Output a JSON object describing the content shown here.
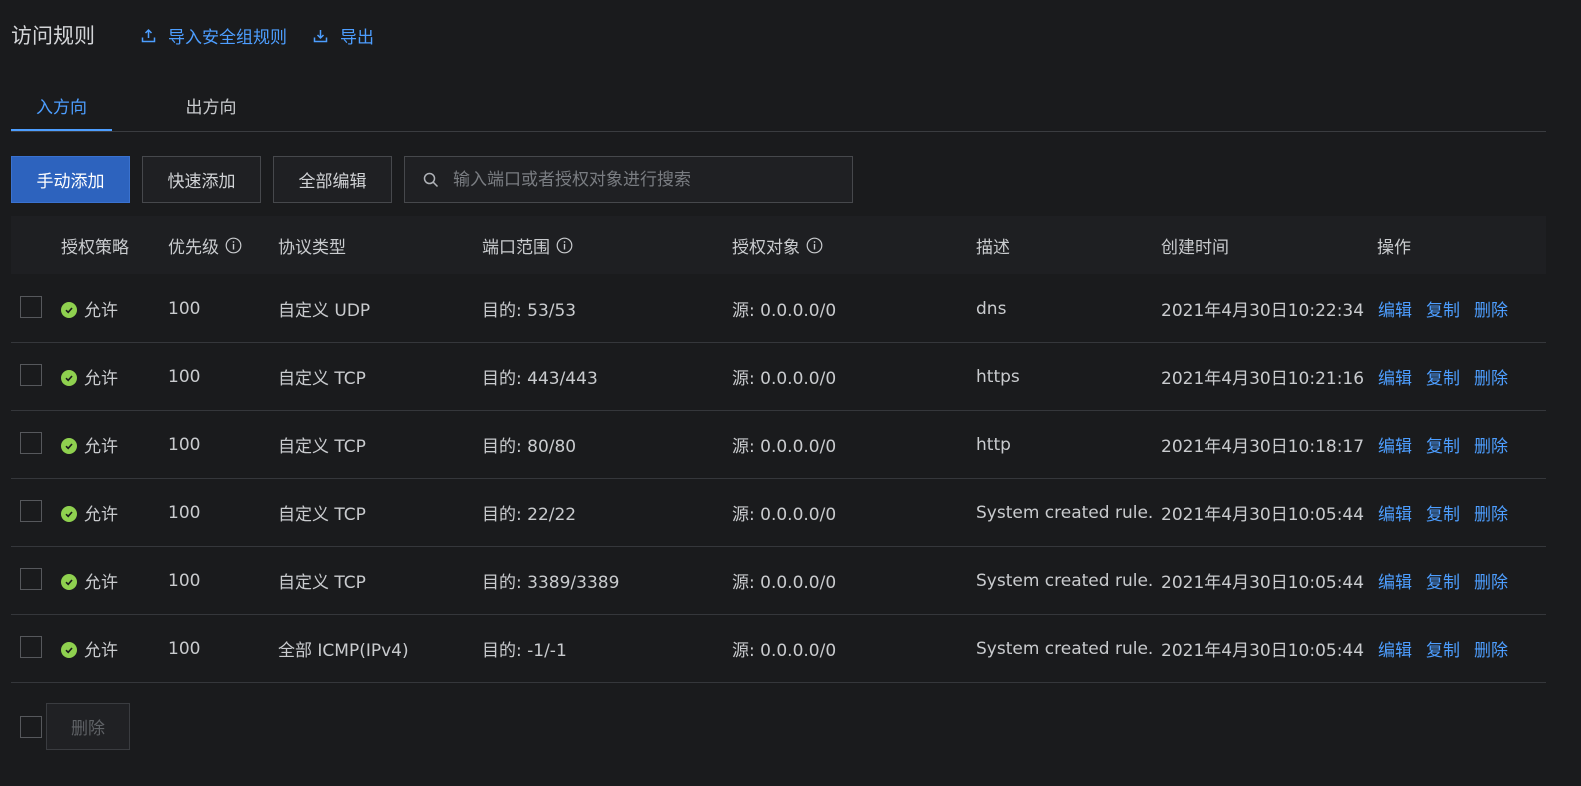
{
  "header": {
    "title": "访问规则",
    "import_label": "导入安全组规则",
    "export_label": "导出"
  },
  "tabs": [
    {
      "label": "入方向",
      "active": true
    },
    {
      "label": "出方向",
      "active": false
    }
  ],
  "toolbar": {
    "manual_add": "手动添加",
    "quick_add": "快速添加",
    "edit_all": "全部编辑",
    "search_placeholder": "输入端口或者授权对象进行搜索"
  },
  "table": {
    "columns": {
      "policy": "授权策略",
      "priority": "优先级",
      "protocol": "协议类型",
      "port_range": "端口范围",
      "auth_object": "授权对象",
      "description": "描述",
      "created": "创建时间",
      "actions": "操作"
    },
    "action_labels": {
      "edit": "编辑",
      "copy": "复制",
      "delete": "删除"
    },
    "rows": [
      {
        "policy": "允许",
        "priority": "100",
        "protocol": "自定义 UDP",
        "port": "目的: 53/53",
        "source": "源: 0.0.0.0/0",
        "desc": "dns",
        "created": "2021年4月30日10:22:34"
      },
      {
        "policy": "允许",
        "priority": "100",
        "protocol": "自定义 TCP",
        "port": "目的: 443/443",
        "source": "源: 0.0.0.0/0",
        "desc": "https",
        "created": "2021年4月30日10:21:16"
      },
      {
        "policy": "允许",
        "priority": "100",
        "protocol": "自定义 TCP",
        "port": "目的: 80/80",
        "source": "源: 0.0.0.0/0",
        "desc": "http",
        "created": "2021年4月30日10:18:17"
      },
      {
        "policy": "允许",
        "priority": "100",
        "protocol": "自定义 TCP",
        "port": "目的: 22/22",
        "source": "源: 0.0.0.0/0",
        "desc": "System created rule.",
        "created": "2021年4月30日10:05:44"
      },
      {
        "policy": "允许",
        "priority": "100",
        "protocol": "自定义 TCP",
        "port": "目的: 3389/3389",
        "source": "源: 0.0.0.0/0",
        "desc": "System created rule.",
        "created": "2021年4月30日10:05:44"
      },
      {
        "policy": "允许",
        "priority": "100",
        "protocol": "全部 ICMP(IPv4)",
        "port": "目的: -1/-1",
        "source": "源: 0.0.0.0/0",
        "desc": "System created rule.",
        "created": "2021年4月30日10:05:44"
      }
    ]
  },
  "footer": {
    "delete_label": "删除"
  },
  "colors": {
    "accent": "#4d9eff",
    "primary_button": "#2d63be",
    "allow_icon": "#8fd14f",
    "background": "#1a1b1d"
  }
}
